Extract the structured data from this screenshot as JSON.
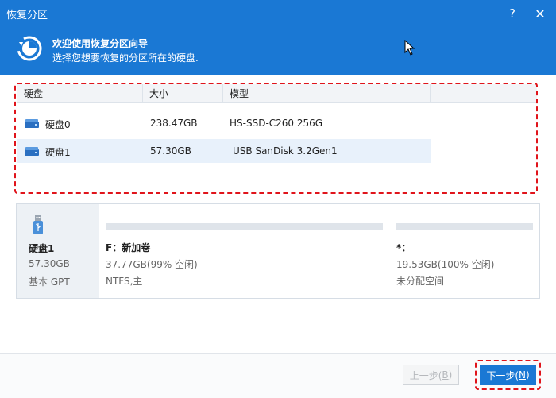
{
  "window": {
    "title": "恢复分区",
    "help_glyph": "?",
    "close_glyph": "✕"
  },
  "header": {
    "heading": "欢迎使用恢复分区向导",
    "subheading": "选择您想要恢复的分区所在的硬盘."
  },
  "table": {
    "columns": [
      "硬盘",
      "大小",
      "模型"
    ],
    "rows": [
      {
        "name": "硬盘0",
        "size": "238.47GB",
        "model": "HS-SSD-C260 256G",
        "selected": false
      },
      {
        "name": "硬盘1",
        "size": "57.30GB",
        "model": "USB SanDisk 3.2Gen1",
        "selected": true
      }
    ]
  },
  "disk_map": {
    "disk": {
      "name": "硬盘1",
      "size": "57.30GB",
      "type": "基本 GPT",
      "icon": "usb-drive-icon"
    },
    "partitions": [
      {
        "name": "F：新加卷",
        "used": "37.77GB(99% 空闲)",
        "fs": "NTFS,主"
      },
      {
        "name": "*：",
        "used": "19.53GB(100% 空闲)",
        "fs": "未分配空间"
      }
    ]
  },
  "footer": {
    "back_label": "上一步(",
    "back_key": "B",
    "back_end": ")",
    "next_label": "下一步(",
    "next_key": "N",
    "next_end": ")"
  },
  "colors": {
    "accent": "#1a78d4",
    "highlight_dash": "#e0141b",
    "selected_row": "#e8f1fb"
  }
}
